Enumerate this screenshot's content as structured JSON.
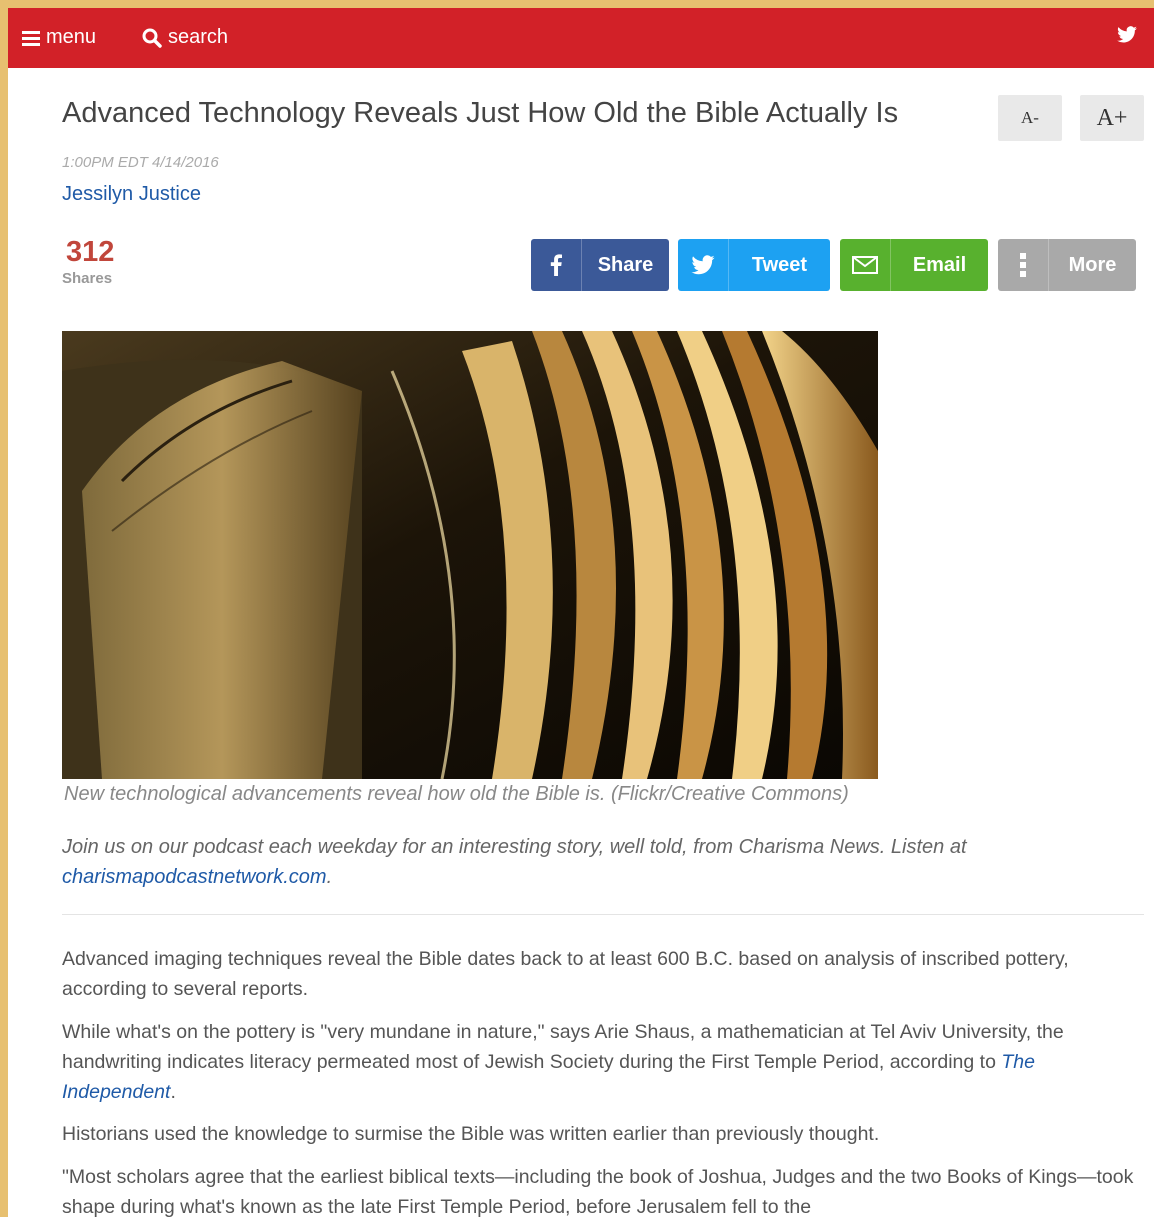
{
  "topbar": {
    "menu_label": "menu",
    "search_label": "search",
    "menu_icon": "hamburger-icon",
    "search_icon": "search-icon",
    "social_icon": "twitter-icon",
    "bg_color": "#d22128"
  },
  "article": {
    "title": "Advanced Technology Reveals Just How Old the Bible Actually Is",
    "font_decrease_label": "A-",
    "font_increase_label": "A+",
    "dateline": "1:00PM EDT 4/14/2016",
    "author": "Jessilyn Justice",
    "share_count": "312",
    "share_count_label": "Shares",
    "share_buttons": [
      {
        "label": "Share",
        "icon": "facebook-icon",
        "color": "#3b5998"
      },
      {
        "label": "Tweet",
        "icon": "twitter-icon",
        "color": "#1da1f2"
      },
      {
        "label": "Email",
        "icon": "envelope-icon",
        "color": "#58b12e"
      },
      {
        "label": "More",
        "icon": "more-icon",
        "color": "#a9a9a9"
      }
    ],
    "image_caption": "New technological advancements reveal how old the Bible is. (Flickr/Creative Commons)",
    "podcast_text": "Join us on our podcast each weekday for an interesting story, well told, from Charisma News. Listen at",
    "podcast_link": "charismapodcastnetwork.com",
    "podcast_period": ".",
    "paragraphs": {
      "p1": "Advanced imaging techniques reveal the Bible dates back to at least 600 B.C. based on analysis of inscribed pottery, according to several reports.",
      "p2_text": "While what's on the pottery is \"very mundane in nature,\" says Arie Shaus, a mathematician at Tel Aviv University, the handwriting indicates literacy permeated most of Jewish Society during the First Temple Period, according to",
      "p2_link": "The Independent",
      "p2_end": ".",
      "p3": "Historians used the knowledge to surmise the Bible was written earlier than previously thought.",
      "p4": "\"Most scholars agree that the earliest biblical texts—including the book of Joshua, Judges and the two Books of Kings—took shape during what's known as the late First Temple Period, before Jerusalem fell to the"
    }
  }
}
